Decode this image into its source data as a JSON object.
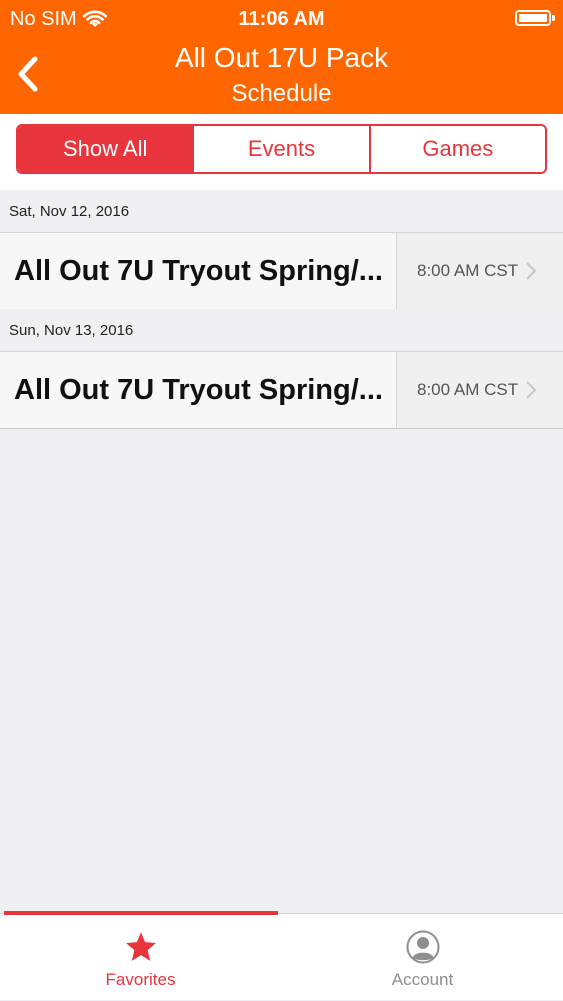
{
  "status_bar": {
    "carrier": "No SIM",
    "time": "11:06 AM"
  },
  "nav": {
    "title": "All Out 17U Pack",
    "subtitle": "Schedule"
  },
  "segments": [
    {
      "label": "Show All",
      "active": true
    },
    {
      "label": "Events",
      "active": false
    },
    {
      "label": "Games",
      "active": false
    }
  ],
  "schedule": [
    {
      "date": "Sat, Nov 12, 2016",
      "title": "All Out 7U Tryout Spring/...",
      "time": "8:00 AM CST"
    },
    {
      "date": "Sun, Nov 13, 2016",
      "title": "All Out 7U Tryout Spring/...",
      "time": "8:00 AM CST"
    }
  ],
  "tabs": [
    {
      "label": "Favorites",
      "icon": "star-icon",
      "active": true
    },
    {
      "label": "Account",
      "icon": "account-icon",
      "active": false
    }
  ],
  "colors": {
    "header": "#ff6600",
    "accent": "#e8353d",
    "inactive_tab": "#8e8e93"
  }
}
